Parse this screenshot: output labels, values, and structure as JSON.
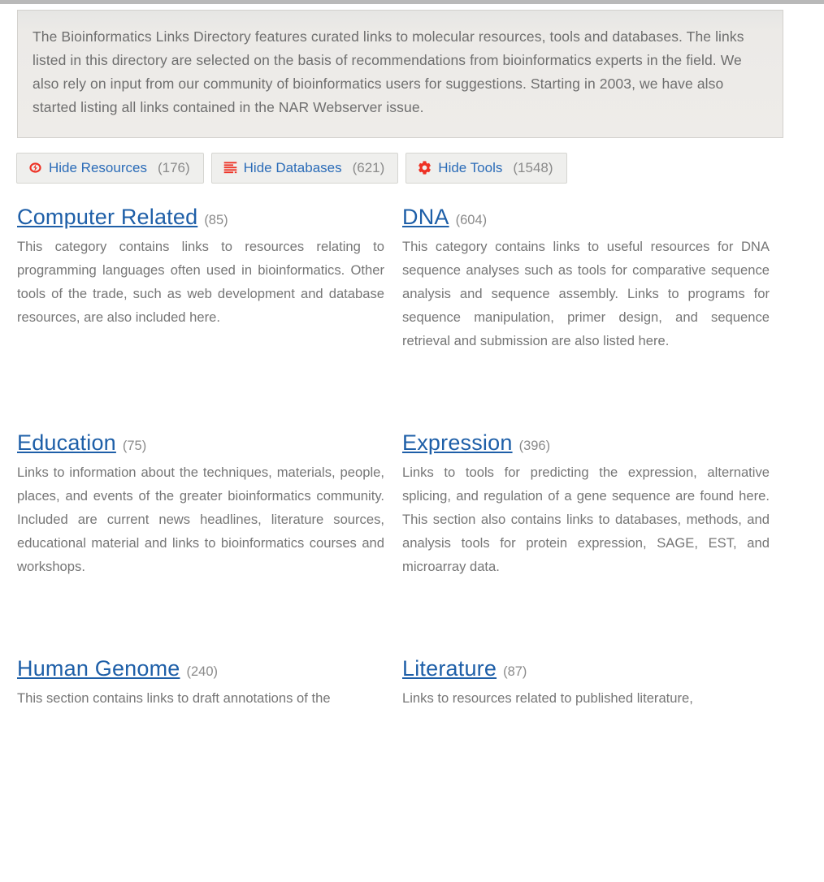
{
  "colors": {
    "link_blue": "#2b6cb8",
    "heading_blue": "#1e5fa8",
    "body_gray": "#767676",
    "icon_red": "#ee3124",
    "count_gray": "#8a8a8a",
    "box_bg": "#eeece9"
  },
  "intro": {
    "text": "The Bioinformatics Links Directory features curated links to molecular resources, tools and databases. The links listed in this directory are selected on the basis of recommendations from bioinformatics experts in the field. We also rely on input from our community of bioinformatics users for suggestions. Starting in 2003, we have also started listing all links contained in the NAR Webserver issue."
  },
  "filters": [
    {
      "icon": "flash-icon",
      "label": "Hide Resources",
      "count": "(176)"
    },
    {
      "icon": "database-list-icon",
      "label": "Hide Databases",
      "count": "(621)"
    },
    {
      "icon": "gear-icon",
      "label": "Hide Tools",
      "count": "(1548)"
    }
  ],
  "categories": [
    {
      "title": "Computer Related",
      "count": "(85)",
      "desc": "This category contains links to resources relating to programming languages often used in bioinformatics. Other tools of the trade, such as web development and database resources, are also included here."
    },
    {
      "title": "DNA",
      "count": "(604)",
      "desc": "This category contains links to useful resources for DNA sequence analyses such as tools for comparative sequence analysis and sequence assembly. Links to programs for sequence manipulation, primer design, and sequence retrieval and submission are also listed here."
    },
    {
      "title": "Education",
      "count": "(75)",
      "desc": "Links to information about the techniques, materials, people, places, and events of the greater bioinformatics community. Included are current news headlines, literature sources, educational material and links to bioinformatics courses and workshops."
    },
    {
      "title": "Expression",
      "count": "(396)",
      "desc": "Links to tools for predicting the expression, alternative splicing, and regulation of a gene sequence are found here. This section also contains links to databases, methods, and analysis tools for protein expression, SAGE, EST, and microarray data."
    },
    {
      "title": "Human Genome",
      "count": "(240)",
      "desc": "This section contains links to draft annotations of the"
    },
    {
      "title": "Literature",
      "count": "(87)",
      "desc": "Links to resources related to published literature,"
    }
  ]
}
